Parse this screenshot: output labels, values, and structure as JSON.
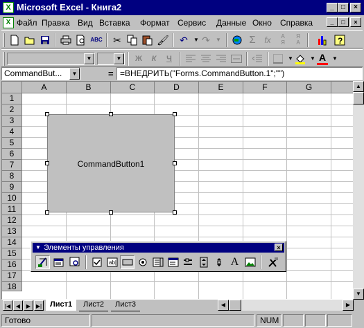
{
  "window": {
    "title": "Microsoft Excel - Книга2",
    "app_icon": "excel-icon",
    "buttons": [
      "_",
      "□",
      "×"
    ]
  },
  "menu": {
    "items": [
      "Файл",
      "Правка",
      "Вид",
      "Вставка",
      "Формат",
      "Сервис",
      "Данные",
      "Окно",
      "Справка"
    ],
    "mdi_buttons": [
      "_",
      "□",
      "×"
    ]
  },
  "standard_toolbar": {
    "icons": [
      "new-icon",
      "open-icon",
      "save-icon",
      "print-icon",
      "print-preview-icon",
      "spelling-icon",
      "cut-icon",
      "copy-icon",
      "paste-icon",
      "format-painter-icon",
      "undo-icon",
      "redo-icon",
      "web-icon",
      "autosum-icon",
      "function-icon",
      "sort-ascending-icon",
      "sort-descending-icon",
      "chart-wizard-icon",
      "help-icon"
    ]
  },
  "formatting_toolbar": {
    "bold": "Ж",
    "italic": "К",
    "underline": "Ч",
    "font_color_letter": "А"
  },
  "formula_bar": {
    "name_box": "CommandBut...",
    "equals": "=",
    "formula": "=ВНЕДРИТЬ(\"Forms.CommandButton.1\";\"\")"
  },
  "grid": {
    "columns": [
      "A",
      "B",
      "C",
      "D",
      "E",
      "F",
      "G"
    ],
    "rows": [
      "1",
      "2",
      "3",
      "4",
      "5",
      "6",
      "7",
      "8",
      "9",
      "10",
      "11",
      "12",
      "13",
      "14",
      "15",
      "16",
      "17",
      "18"
    ]
  },
  "command_button": {
    "caption": "CommandButton1"
  },
  "controls_toolbar": {
    "title": "Элементы управления",
    "close": "×",
    "icons": [
      "design-mode-icon",
      "properties-icon",
      "view-code-icon",
      "checkbox-icon",
      "textbox-icon",
      "command-button-icon",
      "option-button-icon",
      "listbox-icon",
      "combobox-icon",
      "toggle-button-icon",
      "spin-button-icon",
      "scrollbar-icon",
      "label-icon",
      "image-icon",
      "more-controls-icon"
    ]
  },
  "sheets": {
    "tabs": [
      "Лист1",
      "Лист2",
      "Лист3"
    ],
    "active": "Лист1"
  },
  "status": {
    "text": "Готово",
    "num": "NUM"
  },
  "colors": {
    "title_bar": "#000080",
    "face": "#c0c0c0",
    "grid_lines": "#c0c0c0"
  }
}
